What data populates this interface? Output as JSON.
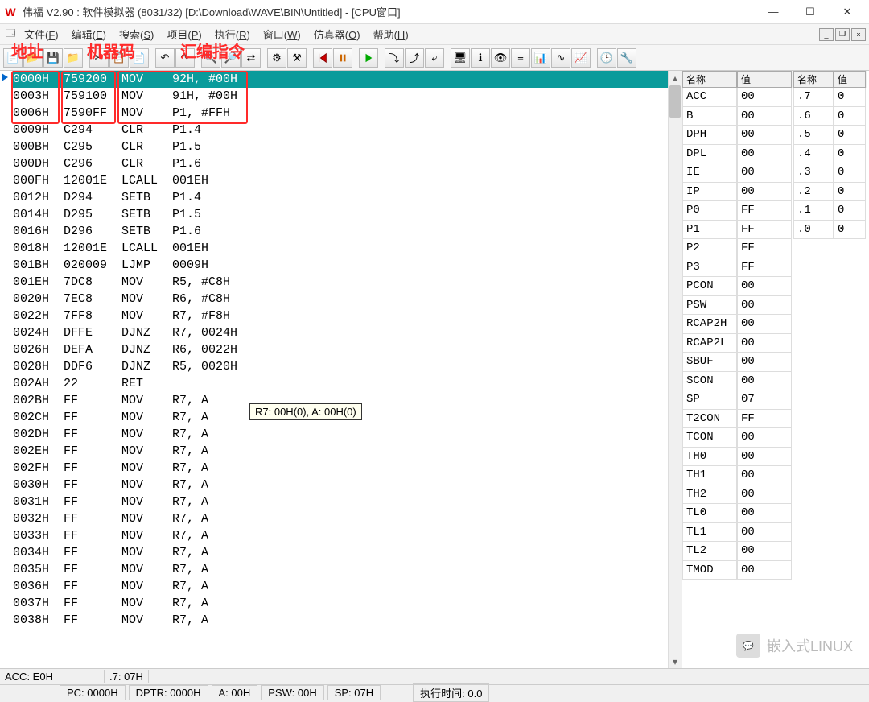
{
  "title": "伟福 V2.90 : 软件模拟器 (8031/32) [D:\\Download\\WAVE\\BIN\\Untitled] - [CPU窗口]",
  "app_icon_letter": "W",
  "win": {
    "min": "—",
    "max": "☐",
    "close": "✕"
  },
  "mdi": {
    "min": "_",
    "restore": "❐",
    "close": "×"
  },
  "menus": [
    {
      "label": "文件",
      "key": "F"
    },
    {
      "label": "编辑",
      "key": "E"
    },
    {
      "label": "搜索",
      "key": "S"
    },
    {
      "label": "项目",
      "key": "P"
    },
    {
      "label": "执行",
      "key": "R"
    },
    {
      "label": "窗口",
      "key": "W"
    },
    {
      "label": "仿真器",
      "key": "O"
    },
    {
      "label": "帮助",
      "key": "H"
    }
  ],
  "annotations": {
    "addr": "地址",
    "machine": "机器码",
    "asm": "汇编指令"
  },
  "code": [
    {
      "addr": "0000H",
      "mc": "759200",
      "op": "MOV",
      "args": "92H, #00H",
      "sel": true
    },
    {
      "addr": "0003H",
      "mc": "759100",
      "op": "MOV",
      "args": "91H, #00H"
    },
    {
      "addr": "0006H",
      "mc": "7590FF",
      "op": "MOV",
      "args": "P1, #FFH"
    },
    {
      "addr": "0009H",
      "mc": "C294",
      "op": "CLR",
      "args": "P1.4"
    },
    {
      "addr": "000BH",
      "mc": "C295",
      "op": "CLR",
      "args": "P1.5"
    },
    {
      "addr": "000DH",
      "mc": "C296",
      "op": "CLR",
      "args": "P1.6"
    },
    {
      "addr": "000FH",
      "mc": "12001E",
      "op": "LCALL",
      "args": "001EH"
    },
    {
      "addr": "0012H",
      "mc": "D294",
      "op": "SETB",
      "args": "P1.4"
    },
    {
      "addr": "0014H",
      "mc": "D295",
      "op": "SETB",
      "args": "P1.5"
    },
    {
      "addr": "0016H",
      "mc": "D296",
      "op": "SETB",
      "args": "P1.6"
    },
    {
      "addr": "0018H",
      "mc": "12001E",
      "op": "LCALL",
      "args": "001EH"
    },
    {
      "addr": "001BH",
      "mc": "020009",
      "op": "LJMP",
      "args": "0009H"
    },
    {
      "addr": "001EH",
      "mc": "7DC8",
      "op": "MOV",
      "args": "R5, #C8H"
    },
    {
      "addr": "0020H",
      "mc": "7EC8",
      "op": "MOV",
      "args": "R6, #C8H"
    },
    {
      "addr": "0022H",
      "mc": "7FF8",
      "op": "MOV",
      "args": "R7, #F8H"
    },
    {
      "addr": "0024H",
      "mc": "DFFE",
      "op": "DJNZ",
      "args": "R7, 0024H"
    },
    {
      "addr": "0026H",
      "mc": "DEFA",
      "op": "DJNZ",
      "args": "R6, 0022H"
    },
    {
      "addr": "0028H",
      "mc": "DDF6",
      "op": "DJNZ",
      "args": "R5, 0020H"
    },
    {
      "addr": "002AH",
      "mc": "22",
      "op": "RET",
      "args": ""
    },
    {
      "addr": "002BH",
      "mc": "FF",
      "op": "MOV",
      "args": "R7, A"
    },
    {
      "addr": "002CH",
      "mc": "FF",
      "op": "MOV",
      "args": "R7, A"
    },
    {
      "addr": "002DH",
      "mc": "FF",
      "op": "MOV",
      "args": "R7, A"
    },
    {
      "addr": "002EH",
      "mc": "FF",
      "op": "MOV",
      "args": "R7, A"
    },
    {
      "addr": "002FH",
      "mc": "FF",
      "op": "MOV",
      "args": "R7, A"
    },
    {
      "addr": "0030H",
      "mc": "FF",
      "op": "MOV",
      "args": "R7, A"
    },
    {
      "addr": "0031H",
      "mc": "FF",
      "op": "MOV",
      "args": "R7, A"
    },
    {
      "addr": "0032H",
      "mc": "FF",
      "op": "MOV",
      "args": "R7, A"
    },
    {
      "addr": "0033H",
      "mc": "FF",
      "op": "MOV",
      "args": "R7, A"
    },
    {
      "addr": "0034H",
      "mc": "FF",
      "op": "MOV",
      "args": "R7, A"
    },
    {
      "addr": "0035H",
      "mc": "FF",
      "op": "MOV",
      "args": "R7, A"
    },
    {
      "addr": "0036H",
      "mc": "FF",
      "op": "MOV",
      "args": "R7, A"
    },
    {
      "addr": "0037H",
      "mc": "FF",
      "op": "MOV",
      "args": "R7, A"
    },
    {
      "addr": "0038H",
      "mc": "FF",
      "op": "MOV",
      "args": "R7, A"
    }
  ],
  "tooltip": "R7: 00H(0), A: 00H(0)",
  "reg_headers": {
    "name": "名称",
    "value": "值"
  },
  "regs_left": [
    {
      "n": "ACC",
      "v": "00"
    },
    {
      "n": "B",
      "v": "00"
    },
    {
      "n": "DPH",
      "v": "00"
    },
    {
      "n": "DPL",
      "v": "00"
    },
    {
      "n": "IE",
      "v": "00"
    },
    {
      "n": "IP",
      "v": "00"
    },
    {
      "n": "P0",
      "v": "FF"
    },
    {
      "n": "P1",
      "v": "FF"
    },
    {
      "n": "P2",
      "v": "FF"
    },
    {
      "n": "P3",
      "v": "FF"
    },
    {
      "n": "PCON",
      "v": "00"
    },
    {
      "n": "PSW",
      "v": "00"
    },
    {
      "n": "RCAP2H",
      "v": "00"
    },
    {
      "n": "RCAP2L",
      "v": "00"
    },
    {
      "n": "SBUF",
      "v": "00"
    },
    {
      "n": "SCON",
      "v": "00"
    },
    {
      "n": "SP",
      "v": "07"
    },
    {
      "n": "T2CON",
      "v": "FF"
    },
    {
      "n": "TCON",
      "v": "00"
    },
    {
      "n": "TH0",
      "v": "00"
    },
    {
      "n": "TH1",
      "v": "00"
    },
    {
      "n": "TH2",
      "v": "00"
    },
    {
      "n": "TL0",
      "v": "00"
    },
    {
      "n": "TL1",
      "v": "00"
    },
    {
      "n": "TL2",
      "v": "00"
    },
    {
      "n": "TMOD",
      "v": "00"
    }
  ],
  "regs_right": [
    {
      "n": ".7",
      "v": "0"
    },
    {
      "n": ".6",
      "v": "0"
    },
    {
      "n": ".5",
      "v": "0"
    },
    {
      "n": ".4",
      "v": "0"
    },
    {
      "n": ".3",
      "v": "0"
    },
    {
      "n": ".2",
      "v": "0"
    },
    {
      "n": ".1",
      "v": "0"
    },
    {
      "n": ".0",
      "v": "0"
    }
  ],
  "status1": {
    "left": "ACC: E0H",
    "right": ".7: 07H"
  },
  "status2": {
    "pc": "PC: 0000H",
    "dptr": "DPTR: 0000H",
    "a": "A: 00H",
    "psw": "PSW: 00H",
    "sp": "SP: 07H",
    "runtime": "执行时间: 0.0"
  },
  "watermark": "嵌入式LINUX"
}
